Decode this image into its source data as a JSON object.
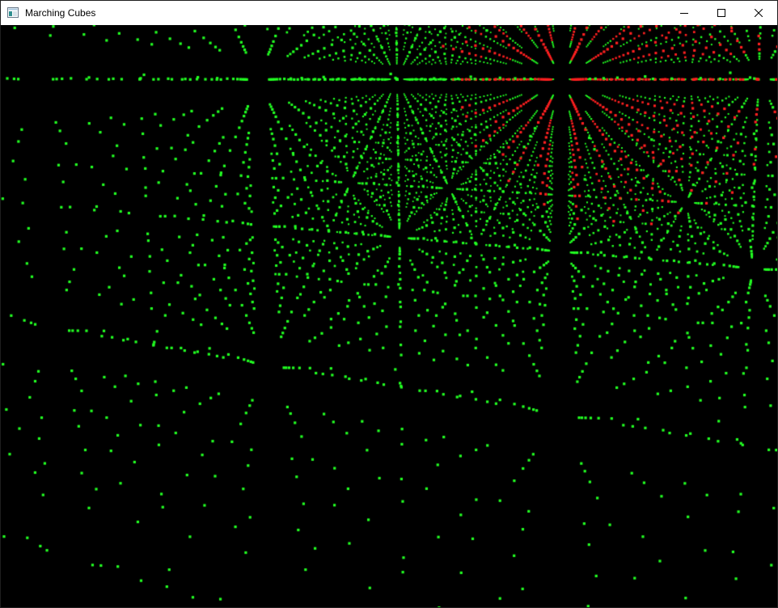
{
  "window": {
    "title": "Marching Cubes",
    "icon": "app-window-icon",
    "controls": {
      "minimize": "minimize-icon",
      "maximize": "maximize-icon",
      "close": "close-icon"
    }
  },
  "scene": {
    "description_colors": {
      "background": "#000000",
      "outside_point": "#22ff22",
      "inside_point": "#ff2020"
    }
  }
}
